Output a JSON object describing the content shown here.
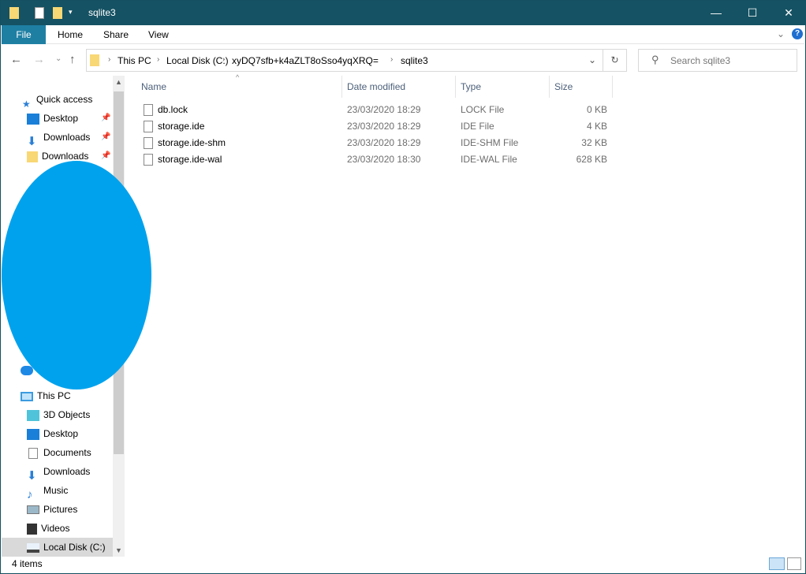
{
  "window": {
    "title": "sqlite3",
    "minimize": "—",
    "maximize": "☐",
    "close": "✕"
  },
  "ribbon": {
    "tabs": [
      "File",
      "Home",
      "Share",
      "View"
    ],
    "expand": "⌄",
    "help": "?"
  },
  "nav": {
    "back": "←",
    "forward": "→",
    "recent": "⌄",
    "up": "↑",
    "refresh": "↻",
    "dropdown": "⌄"
  },
  "breadcrumb": [
    "This PC",
    "Local Disk (C:)",
    "xyDQ7sfb+k4aZLT8oSso4yqXRQ=",
    "sqlite3"
  ],
  "search": {
    "placeholder": "Search sqlite3"
  },
  "sidebar": {
    "quick_access": "Quick access",
    "quick_items": [
      {
        "label": "Desktop",
        "icon": "desktop-icon"
      },
      {
        "label": "Downloads",
        "icon": "download-icon"
      },
      {
        "label": "Downloads",
        "icon": "folder-icon"
      }
    ],
    "this_pc": "This PC",
    "pc_items": [
      {
        "label": "3D Objects",
        "icon": "cube-icon"
      },
      {
        "label": "Desktop",
        "icon": "desktop-icon"
      },
      {
        "label": "Documents",
        "icon": "document-icon"
      },
      {
        "label": "Downloads",
        "icon": "download-icon"
      },
      {
        "label": "Music",
        "icon": "music-icon"
      },
      {
        "label": "Pictures",
        "icon": "pictures-icon"
      },
      {
        "label": "Videos",
        "icon": "videos-icon"
      },
      {
        "label": "Local Disk (C:)",
        "icon": "drive-icon"
      }
    ]
  },
  "columns": [
    "Name",
    "Date modified",
    "Type",
    "Size"
  ],
  "files": [
    {
      "name": "db.lock",
      "date": "23/03/2020 18:29",
      "type": "LOCK File",
      "size": "0 KB"
    },
    {
      "name": "storage.ide",
      "date": "23/03/2020 18:29",
      "type": "IDE File",
      "size": "4 KB"
    },
    {
      "name": "storage.ide-shm",
      "date": "23/03/2020 18:29",
      "type": "IDE-SHM File",
      "size": "32 KB"
    },
    {
      "name": "storage.ide-wal",
      "date": "23/03/2020 18:30",
      "type": "IDE-WAL File",
      "size": "628 KB"
    }
  ],
  "status": {
    "count": "4 items"
  },
  "colors": {
    "titlebar": "#155263",
    "file_tab": "#1f7fa3",
    "redaction": "#00a2ed"
  }
}
